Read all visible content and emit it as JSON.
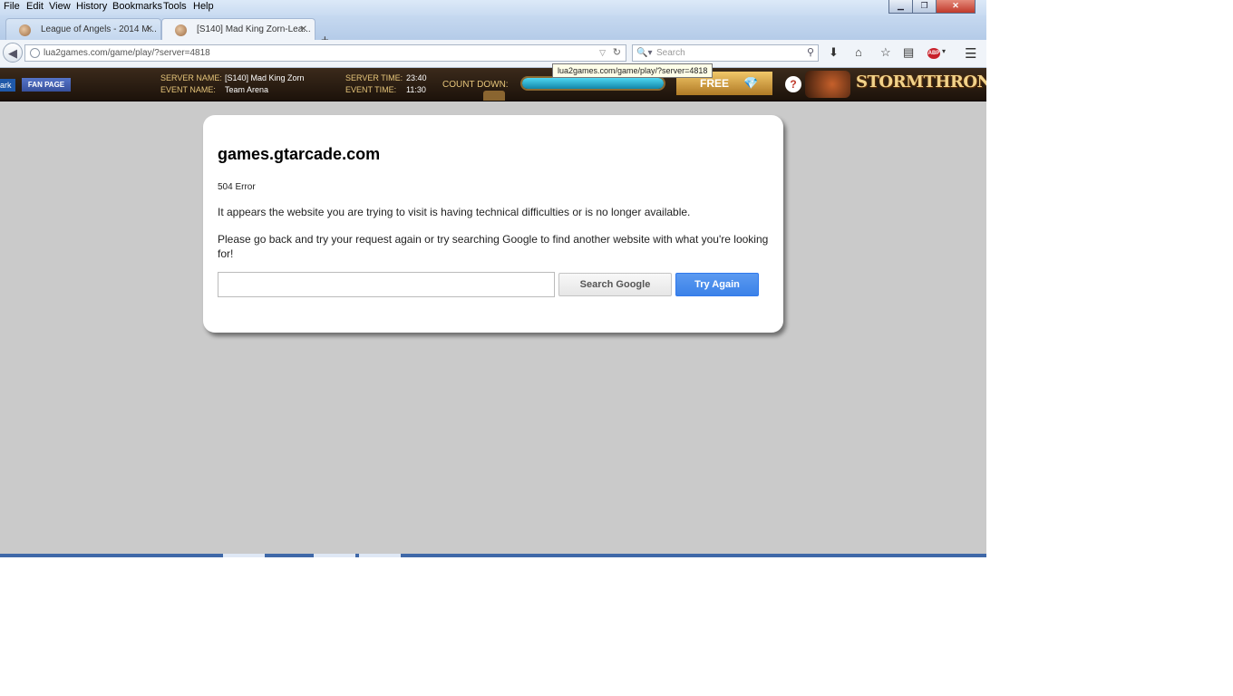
{
  "menu": [
    "File",
    "Edit",
    "View",
    "History",
    "Bookmarks",
    "Tools",
    "Help"
  ],
  "window_controls": {
    "minimize": "▁",
    "maximize": "❐",
    "close": "✕"
  },
  "tabs": [
    {
      "title": "League of Angels - 2014 M...",
      "active": false
    },
    {
      "title": "[S140] Mad King Zorn-Lea...",
      "active": true
    }
  ],
  "new_tab_label": "+",
  "url": "lua2games.com/game/play/?server=4818",
  "search_placeholder": "Search",
  "tooltip": "lua2games.com/game/play/?server=4818",
  "banner": {
    "left_text": "ark",
    "fan_page": "FAN PAGE",
    "server_name_label": "SERVER NAME:",
    "server_name": "[S140] Mad King Zorn",
    "event_name_label": "EVENT NAME:",
    "event_name": "Team Arena",
    "server_time_label": "SERVER TIME:",
    "server_time": "23:40",
    "event_time_label": "EVENT TIME:",
    "event_time": "11:30",
    "countdown_label": "COUNT DOWN:",
    "free_label": "FREE",
    "logo_text": "STORMTHRONE"
  },
  "error": {
    "site": "games.gtarcade.com",
    "code": "504 Error",
    "message1": "It appears the website you are trying to visit is having technical difficulties or is no longer available.",
    "message2": "Please go back and try your request again or try searching Google to find another website with what you're looking for!",
    "search_button": "Search Google",
    "retry_button": "Try Again"
  },
  "colors": {
    "page_background": "#cacaca",
    "retry_button": "#4a8ef0",
    "banner": "#2b1d12",
    "banner_label": "#e6c57a"
  },
  "icons": {
    "back": "back-arrow-icon",
    "reload": "reload-icon",
    "search": "magnifier-icon",
    "download": "download-arrow-icon",
    "home": "home-icon",
    "bookmark": "star-icon",
    "reader": "reading-list-icon",
    "adblock": "adblock-icon",
    "menu": "hamburger-icon"
  }
}
